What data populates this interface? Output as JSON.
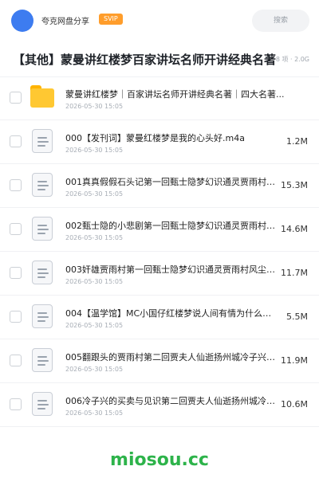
{
  "header": {
    "username": "夸克网盘分享",
    "badge": "SVIP",
    "search_placeholder": "搜索"
  },
  "title": {
    "text": "【其他】蒙曼讲红楼梦百家讲坛名师开讲经典名著",
    "meta": "8 项 · 2.0G"
  },
  "files": [
    {
      "type": "folder",
      "name": "蒙曼讲红楼梦｜百家讲坛名师开讲经典名著｜四大名著...",
      "date": "2026-05-30 15:05",
      "size": ""
    },
    {
      "type": "file",
      "name": "000【发刊词】蒙曼红楼梦是我的心头好.m4a",
      "date": "2026-05-30 15:05",
      "size": "1.2M"
    },
    {
      "type": "file",
      "name": "001真真假假石头记第一回甄士隐梦幻识通灵贾雨村风...",
      "date": "2026-05-30 15:05",
      "size": "15.3M"
    },
    {
      "type": "file",
      "name": "002甄士隐的小悲剧第一回甄士隐梦幻识通灵贾雨村风...",
      "date": "2026-05-30 15:05",
      "size": "14.6M"
    },
    {
      "type": "file",
      "name": "003奸雄贾雨村第一回甄士隐梦幻识通灵贾雨村风尘怀...",
      "date": "2026-05-30 15:05",
      "size": "11.7M"
    },
    {
      "type": "file",
      "name": "004【温学馆】MC小国仔红楼梦说人间有情为什么现...",
      "date": "2026-05-30 15:05",
      "size": "5.5M"
    },
    {
      "type": "file",
      "name": "005翻跟头的贾雨村第二回贾夫人仙逝扬州城冷子兴演...",
      "date": "2026-05-30 15:05",
      "size": "11.9M"
    },
    {
      "type": "file",
      "name": "006冷子兴的买卖与见识第二回贾夫人仙逝扬州城冷子...",
      "date": "2026-05-30 15:05",
      "size": "10.6M"
    }
  ],
  "footer": {
    "watermark": "miosou.cc"
  },
  "colors": {
    "accent": "#3d7cf0",
    "badge": "#ff9d2b",
    "folder": "#ffc832",
    "watermark": "#2db34a"
  }
}
